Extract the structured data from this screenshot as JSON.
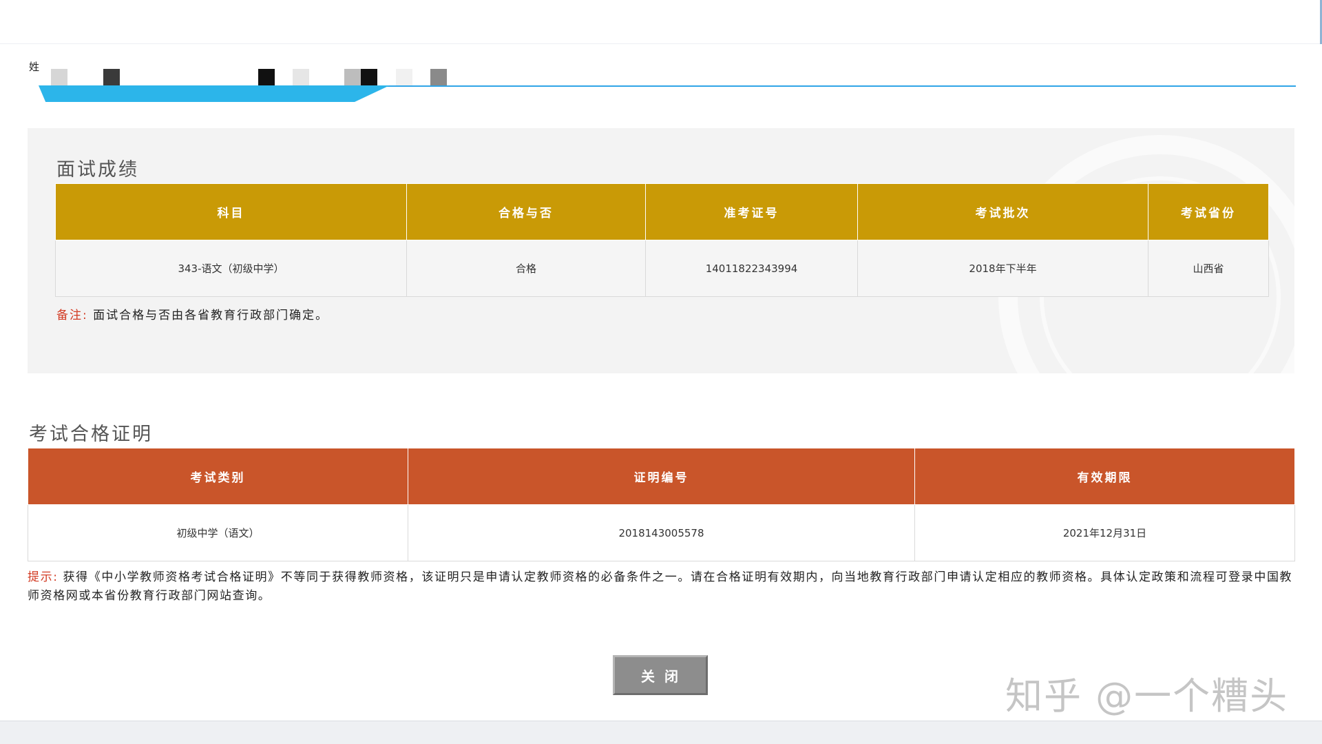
{
  "candidate": {
    "name_label": "姓"
  },
  "interview": {
    "title": "面试成绩",
    "headers": [
      "科目",
      "合格与否",
      "准考证号",
      "考试批次",
      "考试省份"
    ],
    "row": [
      "343-语文（初级中学）",
      "合格",
      "14011822343994",
      "2018年下半年",
      "山西省"
    ],
    "note_label": "备注:",
    "note_text": "面试合格与否由各省教育行政部门确定。"
  },
  "certificate": {
    "title": "考试合格证明",
    "headers": [
      "考试类别",
      "证明编号",
      "有效期限"
    ],
    "row": [
      "初级中学（语文）",
      "2018143005578",
      "2021年12月31日"
    ]
  },
  "tip": {
    "label": "提示:",
    "text": "获得《中小学教师资格考试合格证明》不等同于获得教师资格，该证明只是申请认定教师资格的必备条件之一。请在合格证明有效期内，向当地教育行政部门申请认定相应的教师资格。具体认定政策和流程可登录中国教师资格网或本省份教育行政部门网站查询。"
  },
  "actions": {
    "close_label": "关闭"
  },
  "watermark": {
    "text": "知乎 @一个糟头"
  },
  "colors": {
    "interview_header": "#c99a06",
    "certificate_header": "#c9552a",
    "note_red": "#d23a22",
    "name_tab_blue": "#2cb5ea"
  }
}
